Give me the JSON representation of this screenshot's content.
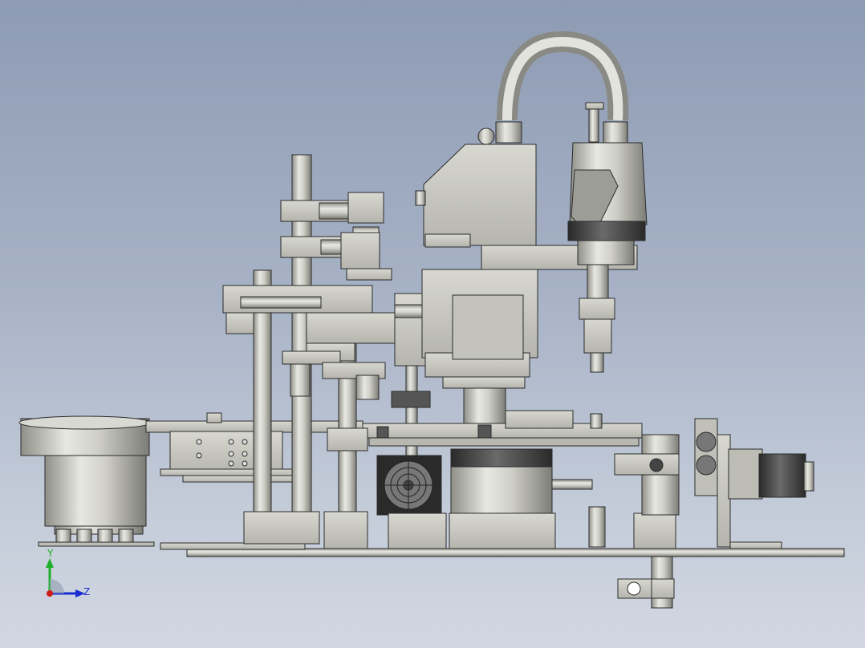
{
  "viewport": {
    "background_top": "#8d9bb3",
    "background_bottom": "#d1d7e2"
  },
  "triad": {
    "y_label": "Y",
    "z_label": "Z",
    "y_axis_color": "#1fae2a",
    "z_axis_color": "#1b2fd0",
    "x_axis_color": "#d01b1b"
  },
  "model": {
    "description_icon": "cad-assembly-icon",
    "metal_color": "#c9c9c2",
    "edge_color": "#2b2b2b",
    "dark_part_color": "#3a3a3a"
  }
}
